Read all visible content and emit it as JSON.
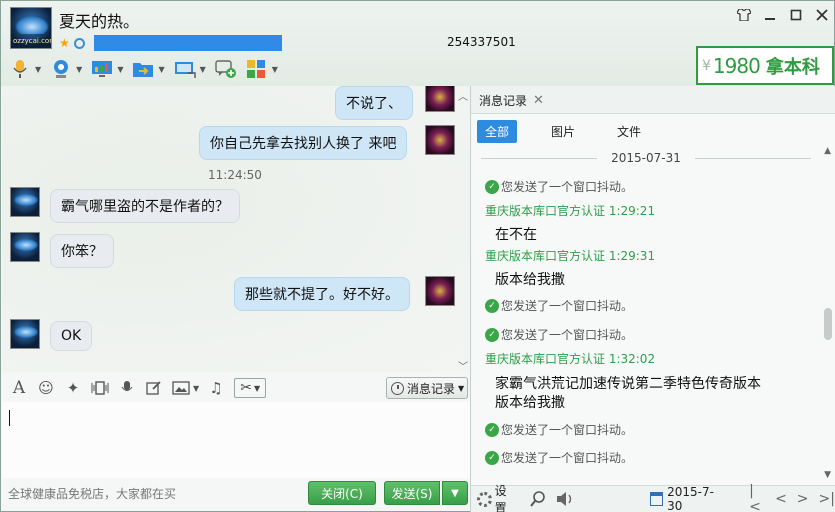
{
  "header": {
    "nickname": "夏天的热。",
    "qq_number": "254337501",
    "avatar_text": "ozzycai.com",
    "window_buttons": [
      "minimize-icon",
      "restore-icon",
      "maximize-icon",
      "close-icon"
    ]
  },
  "toolbar": {
    "items": [
      "microphone-icon",
      "camera-icon",
      "screen-share-icon",
      "transfer-file-icon",
      "remote-desktop-icon",
      "message-plus-icon",
      "apps-icon"
    ]
  },
  "ad": {
    "prefix": "¥",
    "number": "1980",
    "text": "拿本科"
  },
  "chat": {
    "timestamp": "11:24:50",
    "messages": [
      {
        "side": "me",
        "text": "不说了、"
      },
      {
        "side": "me",
        "text": "你自己先拿去找别人换了 来吧"
      },
      {
        "side": "other",
        "text": "霸气哪里盗的不是作者的？"
      },
      {
        "side": "other",
        "text": "你笨？"
      },
      {
        "side": "me",
        "text": "那些就不提了。好不好。"
      },
      {
        "side": "other",
        "text": "OK"
      }
    ]
  },
  "edit_toolbar": {
    "history_label": "消息记录"
  },
  "footer": {
    "ad_text": "全球健康品免税店，大家都在买",
    "close_label": "关闭(C)",
    "send_label": "发送(S)"
  },
  "history": {
    "tab_label": "消息记录",
    "filters": [
      "全部",
      "图片",
      "文件"
    ],
    "date": "2015-07-31",
    "entries": [
      {
        "type": "shake",
        "text": "您发送了一个窗口抖动。"
      },
      {
        "type": "sender",
        "text": "重庆版本库口官方认证 1:29:21"
      },
      {
        "type": "text",
        "text": "在不在"
      },
      {
        "type": "sender",
        "text": "重庆版本库口官方认证 1:29:31"
      },
      {
        "type": "text",
        "text": "版本给我撒"
      },
      {
        "type": "shake",
        "text": "您发送了一个窗口抖动。"
      },
      {
        "type": "shake",
        "text": "您发送了一个窗口抖动。"
      },
      {
        "type": "sender",
        "text": "重庆版本库口官方认证 1:32:02"
      },
      {
        "type": "text",
        "text": "家霸气洪荒记加速传说第二季特色传奇版本"
      },
      {
        "type": "text",
        "text": "版本给我撒"
      },
      {
        "type": "shake",
        "text": "您发送了一个窗口抖动。"
      },
      {
        "type": "shake",
        "text": "您发送了一个窗口抖动。"
      }
    ],
    "settings_label": "设置",
    "current_date": "2015-7-30"
  },
  "colors": {
    "accent_blue": "#2e8ce0",
    "send_green": "#3a9e48",
    "sender_green": "#2f9d4a"
  }
}
